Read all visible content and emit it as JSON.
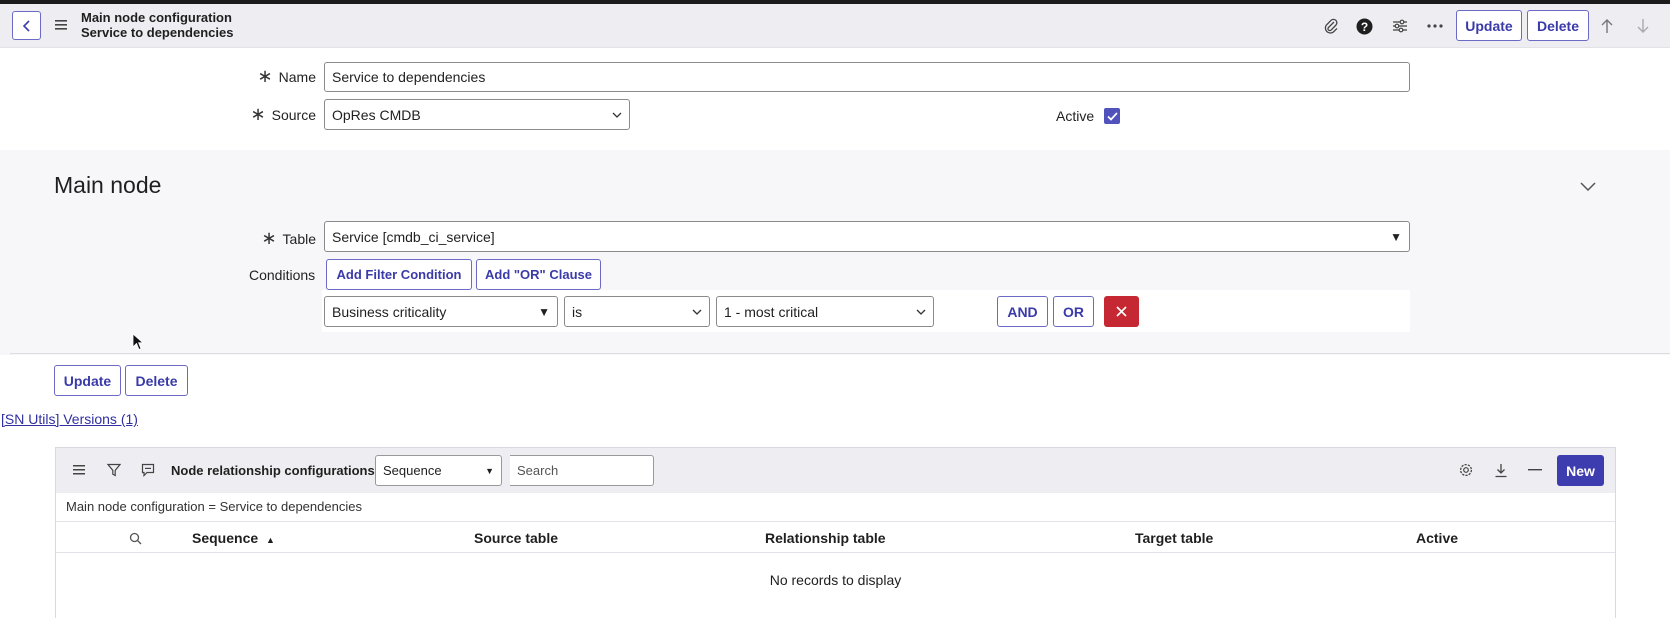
{
  "header": {
    "title": "Main node configuration",
    "subtitle": "Service to dependencies",
    "update_label": "Update",
    "delete_label": "Delete"
  },
  "form": {
    "name_label": "Name",
    "name_value": "Service to dependencies",
    "source_label": "Source",
    "source_value": "OpRes CMDB",
    "active_label": "Active",
    "active_checked": true
  },
  "main_node": {
    "title": "Main node",
    "table_label": "Table",
    "table_value": "Service [cmdb_ci_service]",
    "conditions_label": "Conditions",
    "add_filter_label": "Add Filter Condition",
    "add_or_label": "Add \"OR\" Clause",
    "condition": {
      "field": "Business criticality",
      "operator": "is",
      "value": "1 - most critical"
    },
    "and_label": "AND",
    "or_label": "OR"
  },
  "actions": {
    "update_label": "Update",
    "delete_label": "Delete"
  },
  "versions_link": "[SN Utils] Versions (1)",
  "related_list": {
    "title": "Node relationship configurations",
    "sort_value": "Sequence",
    "search_placeholder": "Search",
    "new_label": "New",
    "breadcrumb": "Main node configuration = Service to dependencies",
    "columns": [
      "Sequence",
      "Source table",
      "Relationship table",
      "Target table",
      "Active"
    ],
    "empty_text": "No records to display"
  },
  "colors": {
    "accent": "#3d3db0",
    "header_bg": "#eeeef2",
    "danger": "#c62833",
    "checkbox": "#5252bd"
  }
}
